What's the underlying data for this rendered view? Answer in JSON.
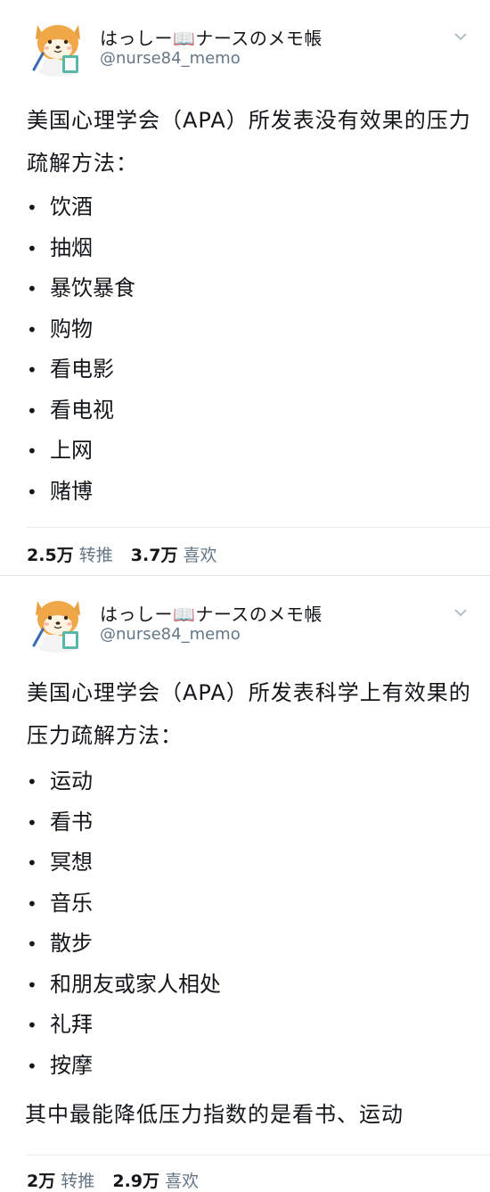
{
  "tweets": [
    {
      "author_name": "はっしー📖ナースのメモ帳",
      "handle": "@nurse84_memo",
      "intro": "美国心理学会（APA）所发表没有效果的压力疏解方法：",
      "items": [
        "饮酒",
        "抽烟",
        "暴饮暴食",
        "购物",
        "看电影",
        "看电视",
        "上网",
        "赌博"
      ],
      "summary": "",
      "retweets": "2.5万",
      "retweets_label": "转推",
      "likes": "3.7万",
      "likes_label": "喜欢"
    },
    {
      "author_name": "はっしー📖ナースのメモ帳",
      "handle": "@nurse84_memo",
      "intro": "美国心理学会（APA）所发表科学上有效果的压力疏解方法：",
      "items": [
        "运动",
        "看书",
        "冥想",
        "音乐",
        "散步",
        "和朋友或家人相处",
        "礼拜",
        "按摩"
      ],
      "summary": "其中最能降低压力指数的是看书、运动",
      "retweets": "2万",
      "retweets_label": "转推",
      "likes": "2.9万",
      "likes_label": "喜欢"
    }
  ],
  "bullet_char": "•",
  "icons": {
    "avatar": "shiba-dog-avatar-icon",
    "caret": "chevron-down-icon"
  },
  "colors": {
    "text": "#14171a",
    "secondary": "#657786",
    "divider": "#e6ecf0"
  }
}
